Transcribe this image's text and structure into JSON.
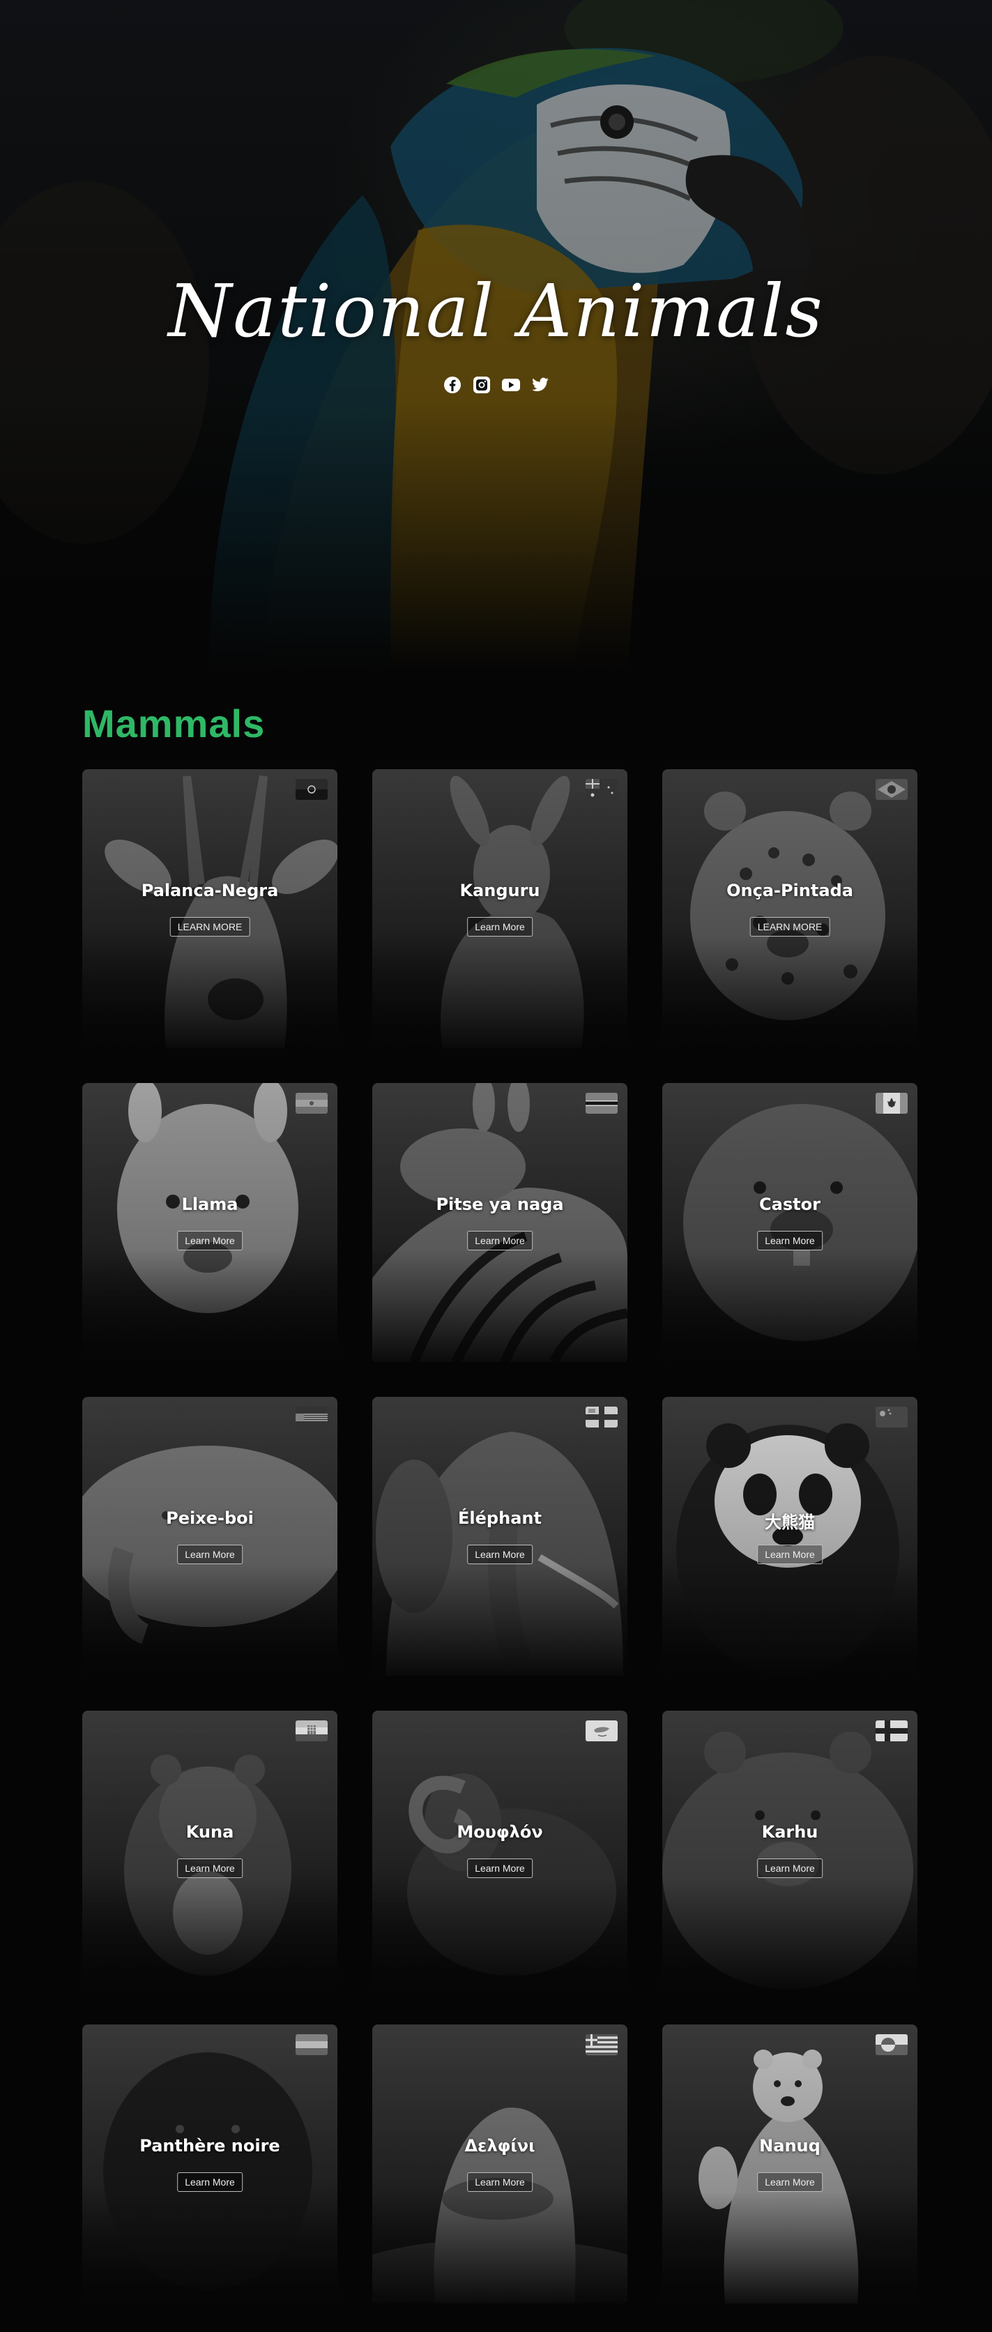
{
  "hero": {
    "title": "National Animals",
    "socials": [
      {
        "icon": "facebook-icon"
      },
      {
        "icon": "instagram-icon"
      },
      {
        "icon": "youtube-icon"
      },
      {
        "icon": "twitter-icon"
      }
    ]
  },
  "section": {
    "title": "Mammals",
    "accent_color": "#2fb866"
  },
  "cards": [
    {
      "name": "Palanca-Negra",
      "button": "LEARN MORE",
      "flag": "angola-flag",
      "art": "sable-antelope"
    },
    {
      "name": "Kanguru",
      "button": "Learn More",
      "flag": "australia-flag",
      "art": "kangaroo"
    },
    {
      "name": "Onça-Pintada",
      "button": "LEARN MORE",
      "flag": "brazil-flag",
      "art": "jaguar"
    },
    {
      "name": "Llama",
      "button": "Learn More",
      "flag": "bolivia-flag",
      "art": "llama"
    },
    {
      "name": "Pitse ya naga",
      "button": "Learn More",
      "flag": "botswana-flag",
      "art": "zebra"
    },
    {
      "name": "Castor",
      "button": "Learn More",
      "flag": "canada-flag",
      "art": "beaver"
    },
    {
      "name": "Peixe-boi",
      "button": "Learn More",
      "flag": "striped-flag",
      "art": "manatee"
    },
    {
      "name": "Éléphant",
      "button": "Learn More",
      "flag": "cross-flag",
      "art": "elephant"
    },
    {
      "name": "大熊猫",
      "button": "Learn More",
      "flag": "china-flag",
      "art": "panda"
    },
    {
      "name": "Kuna",
      "button": "Learn More",
      "flag": "croatia-flag",
      "art": "marten"
    },
    {
      "name": "Μουφλόν",
      "button": "Learn More",
      "flag": "cyprus-flag",
      "art": "mouflon"
    },
    {
      "name": "Karhu",
      "button": "Learn More",
      "flag": "finland-flag",
      "art": "bear"
    },
    {
      "name": "Panthère noire",
      "button": "Learn More",
      "flag": "gabon-flag",
      "art": "panther"
    },
    {
      "name": "Δελφίνι",
      "button": "Learn More",
      "flag": "greece-flag",
      "art": "dolphin"
    },
    {
      "name": "Nanuq",
      "button": "Learn More",
      "flag": "greenland-flag",
      "art": "polar-bear"
    }
  ]
}
